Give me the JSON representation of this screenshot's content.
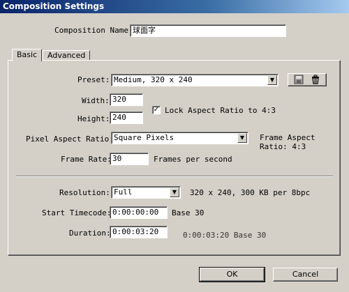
{
  "window": {
    "title": "Composition Settings"
  },
  "composition_name": {
    "label": "Composition Name:",
    "value": "球面字"
  },
  "tabs": [
    {
      "label": "Basic"
    },
    {
      "label": "Advanced"
    }
  ],
  "basic": {
    "preset": {
      "label": "Preset:",
      "value": "Medium, 320 x 240"
    },
    "width": {
      "label": "Width:",
      "value": "320"
    },
    "height": {
      "label": "Height:",
      "value": "240"
    },
    "lock_aspect": {
      "label": "Lock Aspect Ratio to 4:3",
      "checked": true
    },
    "pixel_aspect": {
      "label": "Pixel Aspect Ratio:",
      "value": "Square Pixels"
    },
    "frame_aspect": {
      "line1": "Frame Aspect",
      "line2": "Ratio: 4:3"
    },
    "frame_rate": {
      "label": "Frame Rate:",
      "value": "30",
      "unit": "Frames per second"
    },
    "resolution": {
      "label": "Resolution:",
      "value": "Full",
      "info": "320 x 240, 300 KB per 8bpc"
    },
    "start_timecode": {
      "label": "Start Timecode:",
      "value": "0:00:00:00",
      "info": "Base 30"
    },
    "duration": {
      "label": "Duration:",
      "value": "0:00:03:20",
      "info": "0:00:03:20 Base 30"
    }
  },
  "buttons": {
    "ok": "OK",
    "cancel": "Cancel"
  },
  "icons": {
    "save": "save-preset-icon",
    "delete": "trash-icon"
  }
}
